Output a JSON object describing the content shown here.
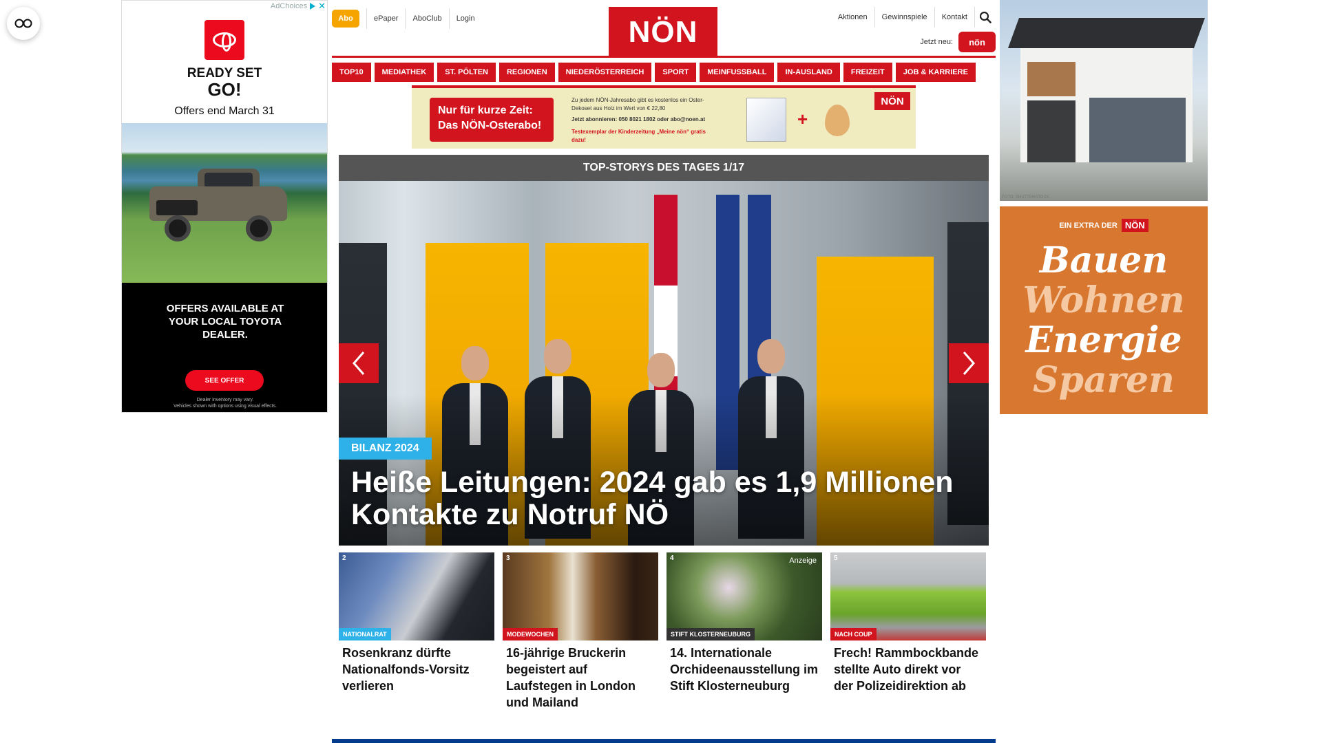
{
  "left_ad": {
    "adchoices": "AdChoices",
    "ready_set": "READY SET",
    "go": "GO!",
    "offers_end": "Offers end March 31",
    "offers_available": "OFFERS AVAILABLE AT YOUR LOCAL TOYOTA DEALER.",
    "cta": "SEE OFFER",
    "fine_print_1": "Dealer inventory may vary.",
    "fine_print_2": "Vehicles shown with options using visual effects."
  },
  "topbar": {
    "abo": "Abo",
    "links": [
      "ePaper",
      "AboClub",
      "Login"
    ],
    "logo": "NÖN",
    "right_links": [
      "Aktionen",
      "Gewinnspiele",
      "Kontakt"
    ],
    "jetzt_neu": "Jetzt neu:",
    "app_badge": "nön"
  },
  "nav": [
    "TOP10",
    "MEDIATHEK",
    "ST. PÖLTEN",
    "REGIONEN",
    "NIEDERÖSTERREICH",
    "SPORT",
    "MEINFUSSBALL",
    "IN-AUSLAND",
    "FREIZEIT",
    "JOB & KARRIERE"
  ],
  "banner": {
    "headline_1": "Nur für kurze Zeit:",
    "headline_2": "Das NÖN-Osterabo!",
    "text_1": "Zu jedem NÖN-Jahresabo gibt es kostenlos ein Oster-Dekoset aus Holz im Wert von € 22,80",
    "text_2": "Jetzt abonnieren: 050 8021 1802 oder abo@noen.at",
    "text_3": "Testexemplar der Kinderzeitung „Meine nön“ gratis dazu!",
    "logo": "NÖN"
  },
  "top_stories": {
    "header": "TOP-STORYS DES TAGES 1/17",
    "hero_tag": "BILANZ 2024",
    "hero_title": "Heiße Leitungen: 2024 gab es 1,9 Millionen Kontakte zu Notruf NÖ"
  },
  "cards": [
    {
      "num": "2",
      "tag": "NATIONALRAT",
      "title": "Rosenkranz dürfte Nationalfonds-Vorsitz verlieren",
      "anzeige": ""
    },
    {
      "num": "3",
      "tag": "MODEWOCHEN",
      "title": "16-jährige Bruckerin begeistert auf Laufstegen in London und Mailand",
      "anzeige": ""
    },
    {
      "num": "4",
      "tag": "STIFT KLOSTERNEUBURG",
      "title": "14. Internationale Orchideenausstellung im Stift Klosterneuburg",
      "anzeige": "Anzeige"
    },
    {
      "num": "5",
      "tag": "NACH COUP",
      "title": "Frech! Rammbockbande stellte Auto direkt vor der Polizeidirektion ab",
      "anzeige": ""
    }
  ],
  "right_ad_1": {
    "credit": "FOTO: SHUTTERSTOCK"
  },
  "right_ad_2": {
    "extra_label": "EIN EXTRA DER",
    "logo": "NÖN",
    "words": [
      "Bauen",
      "Wohnen",
      "Energie",
      "Sparen"
    ]
  },
  "colors": {
    "brand_red": "#d2141e",
    "abo_orange": "#f5a400",
    "tag_blue": "#2db1e8",
    "footer_blue": "#003b8e"
  }
}
